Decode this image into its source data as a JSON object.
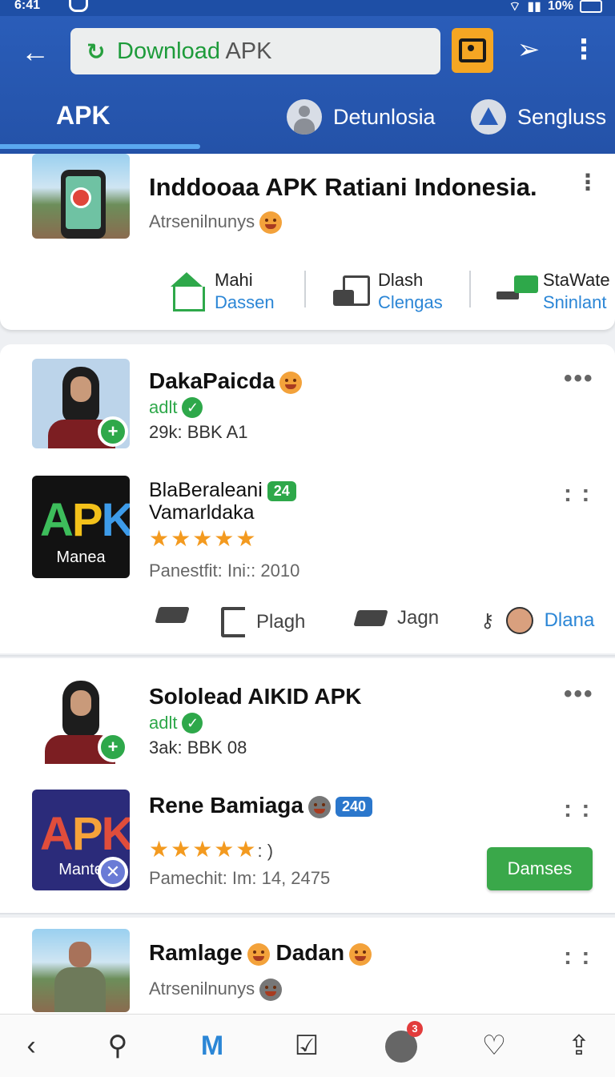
{
  "status_bar": {
    "time": "6:41",
    "battery": "10%"
  },
  "app_bar": {
    "search_label_green": "Download",
    "search_label_grey": "APK",
    "active_tab": "APK",
    "tab_chips": [
      {
        "label": "Detunlosia",
        "icon": "person-icon"
      },
      {
        "label": "Sengluss",
        "icon": "triangle-icon"
      }
    ]
  },
  "featured": {
    "title": "Inddooaa APK Ratiani Indonesia.",
    "subtitle": "Atrsenilnunys",
    "actions": [
      {
        "line1": "Mahi",
        "line2": "Dassen",
        "icon": "home-icon"
      },
      {
        "line1": "Dlash",
        "line2": "Clengas",
        "icon": "chat-doc-icon"
      },
      {
        "line1": "StaWate",
        "line2": "Sninlant",
        "icon": "mail-forward-icon"
      }
    ]
  },
  "post1": {
    "author": "DakaPaicda",
    "verified_label": "adlt",
    "meta": "29k: BBK A1",
    "app_name_line1": "BlaBeraleani",
    "app_name_badge": "24",
    "app_name_line2": "Vamarldaka",
    "rating": 5,
    "rating_text": "★★★★★",
    "details": "Panestfit: Ini:: 2010",
    "icon_text": "APK",
    "icon_caption": "Manea",
    "actions": [
      {
        "label": "",
        "icon": "share-icon"
      },
      {
        "label": "Plagh",
        "icon": "copy-icon"
      },
      {
        "label": "Jagn",
        "icon": "share-icon"
      },
      {
        "label": "Dlana",
        "icon": "avatar"
      }
    ]
  },
  "post2": {
    "author": "Sololead AIKID APK",
    "verified_label": "adlt",
    "meta": "3ak: BBK 08",
    "app_name": "Rene Bamiaga",
    "app_name_badge": "240",
    "rating": 4.5,
    "rating_text": "★★★★★",
    "rating_suffix": ": )",
    "details": "Pamechit: Im: 14, 2475",
    "icon_text": "APK",
    "icon_caption": "Mante",
    "button_label": "Damses"
  },
  "post3": {
    "title_a": "Ramlage",
    "title_b": "Dadan",
    "subtitle": "Atrsenilnunys"
  },
  "bottom_nav": {
    "items": [
      "back-icon",
      "search-icon",
      "mail-icon",
      "edit-icon",
      "chat-icon",
      "heart-icon",
      "share-icon"
    ],
    "badge": "3"
  },
  "colors": {
    "primary": "#2a5db9",
    "accent_green": "#2ea84a",
    "accent_orange": "#f5a623",
    "link_blue": "#2b86d6"
  }
}
